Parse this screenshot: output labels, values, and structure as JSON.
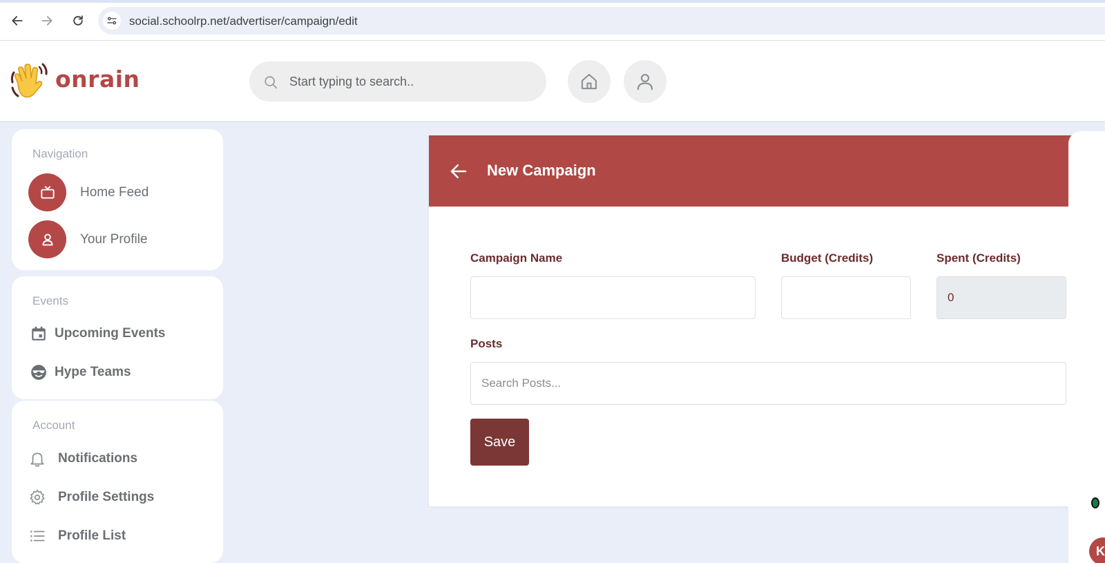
{
  "browser": {
    "url": "social.schoolrp.net/advertiser/campaign/edit"
  },
  "header": {
    "logo_text": "onrain",
    "search_placeholder": "Start typing to search.."
  },
  "sidebar": {
    "navigation": {
      "title": "Navigation",
      "items": [
        {
          "label": "Home Feed",
          "icon": "tv-icon"
        },
        {
          "label": "Your Profile",
          "icon": "user-icon"
        }
      ]
    },
    "events": {
      "title": "Events",
      "items": [
        {
          "label": "Upcoming Events",
          "icon": "calendar-icon"
        },
        {
          "label": "Hype Teams",
          "icon": "sunglasses-face-icon"
        }
      ]
    },
    "account": {
      "title": "Account",
      "items": [
        {
          "label": "Notifications",
          "icon": "bell-icon"
        },
        {
          "label": "Profile Settings",
          "icon": "gear-icon"
        },
        {
          "label": "Profile List",
          "icon": "list-icon"
        }
      ]
    }
  },
  "form": {
    "title": "New Campaign",
    "campaign_name_label": "Campaign Name",
    "campaign_name_value": "",
    "budget_label": "Budget (Credits)",
    "budget_value": "",
    "spent_label": "Spent (Credits)",
    "spent_value": "0",
    "posts_label": "Posts",
    "posts_placeholder": "Search Posts...",
    "save_label": "Save"
  },
  "right_panel": {
    "avatar_initials": "KA"
  },
  "colors": {
    "brand": "#b34847",
    "panel_header": "#b04845",
    "save_button": "#7b3636",
    "label": "#6c2b2b",
    "page_bg": "#e9eef8"
  }
}
